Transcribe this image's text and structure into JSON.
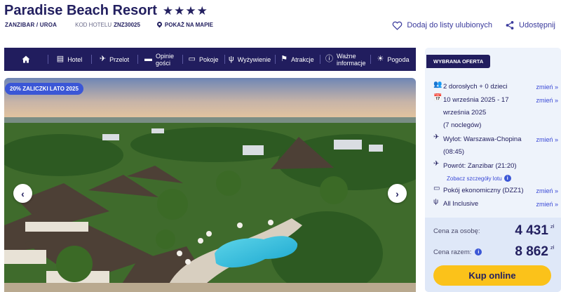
{
  "hotel": {
    "name": "Paradise Beach Resort",
    "stars": "★★★★",
    "location": "ZANZIBAR / UROA",
    "code_label": "KOD HOTELU",
    "code": "ZNZ30025",
    "map_link": "POKAŻ NA MAPIE"
  },
  "actions": {
    "favorites": "Dodaj do listy ulubionych",
    "share": "Udostępnij"
  },
  "nav": [
    {
      "label": "",
      "icon": "home-icon"
    },
    {
      "label": "Hotel",
      "icon": "hotel-icon"
    },
    {
      "label": "Przelot",
      "icon": "plane-icon"
    },
    {
      "label": "Opinie gości",
      "icon": "chat-icon"
    },
    {
      "label": "Pokoje",
      "icon": "bed-icon"
    },
    {
      "label": "Wyżywienie",
      "icon": "cutlery-icon"
    },
    {
      "label": "Atrakcje",
      "icon": "signpost-icon"
    },
    {
      "label": "Ważne informacje",
      "icon": "info-icon"
    },
    {
      "label": "Pogoda",
      "icon": "sun-icon"
    }
  ],
  "hero": {
    "badge": "20% ZALICZKI LATO 2025"
  },
  "offer": {
    "label": "WYBRANA OFERTA",
    "change_label": "zmień »",
    "guests": "2 dorosłych + 0 dzieci",
    "dates": "10 września 2025 - 17 września 2025",
    "nights": "(7 noclegów)",
    "departure": "Wylot: Warszawa-Chopina (08:45)",
    "return": "Powrót: Zanzibar (21:20)",
    "flight_details": "Zobacz szczegóły lotu",
    "room": "Pokój ekonomiczny (DZZ1)",
    "board": "All Inclusive"
  },
  "price": {
    "per_person_label": "Cena za osobę:",
    "per_person": "4 431",
    "total_label": "Cena razem:",
    "total": "8 862",
    "currency": "zł",
    "buy_label": "Kup online"
  },
  "colors": {
    "navy": "#211d5e",
    "accent_blue": "#3b57d6",
    "buy_yellow": "#fbc21a"
  }
}
